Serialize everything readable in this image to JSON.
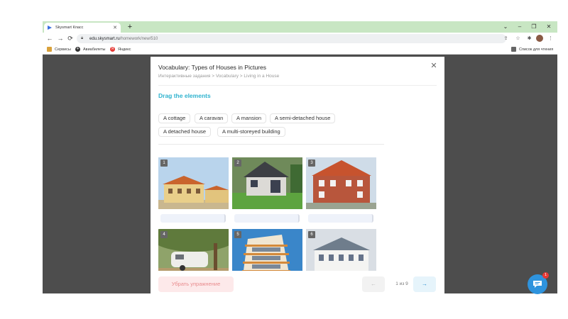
{
  "browser": {
    "tab_title": "Skysmart Класс",
    "new_tab": "+",
    "window": {
      "minimize": "–",
      "restore": "❐",
      "close": "✕",
      "tabs_menu": "⌄"
    },
    "nav": {
      "back": "←",
      "forward": "→",
      "reload": "⟳"
    },
    "url_host": "edu.skysmart.ru",
    "url_path": "/homework/new/510",
    "bookmarks": [
      {
        "label": "Сервисы",
        "icon": "apps-grid-icon"
      },
      {
        "label": "Авиабилеты",
        "icon": "airplane-icon"
      },
      {
        "label": "Яндекс",
        "icon": "yandex-icon"
      }
    ],
    "reading_list": "Список для чтения"
  },
  "modal": {
    "title": "Vocabulary: Types of Houses in Pictures",
    "breadcrumb": "Интерактивные задания > Vocabulary > Living in a House",
    "close": "✕",
    "instruction": "Drag the elements",
    "chips": [
      "A cottage",
      "A caravan",
      "A mansion",
      "A semi-detached house",
      "A detached house",
      "A multi-storeyed building"
    ],
    "cards": [
      {
        "number": "1"
      },
      {
        "number": "2"
      },
      {
        "number": "3"
      },
      {
        "number": "4"
      },
      {
        "number": "5"
      },
      {
        "number": "6"
      }
    ]
  },
  "footer": {
    "remove_label": "Убрать упражнение",
    "prev": "←",
    "pager": "1 из 9",
    "next": "→"
  },
  "chat": {
    "badge": "1"
  }
}
